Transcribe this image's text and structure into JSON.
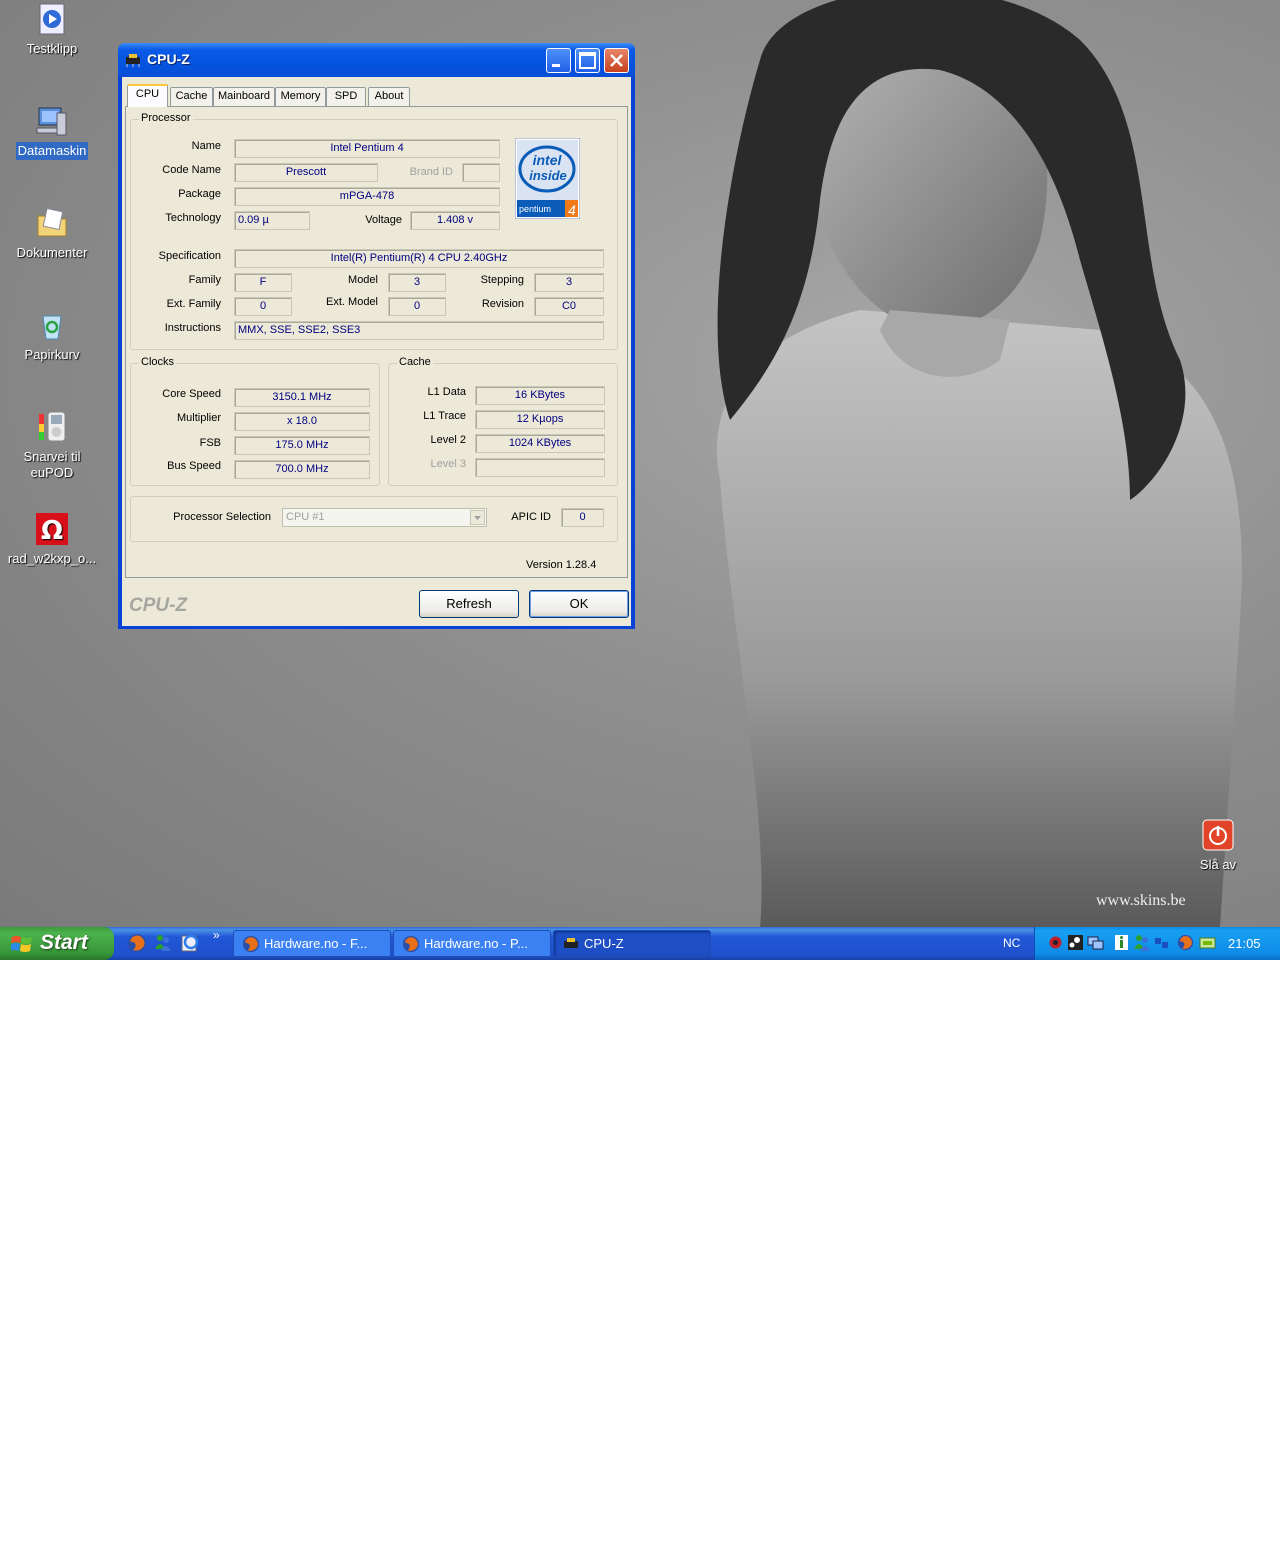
{
  "desktop": {
    "icons": [
      {
        "label": "Testklipp",
        "icon": "media-clip-icon"
      },
      {
        "label": "Datamaskin",
        "icon": "computer-icon"
      },
      {
        "label": "Dokumenter",
        "icon": "documents-folder-icon"
      },
      {
        "label": "Papirkurv",
        "icon": "recycle-bin-icon"
      },
      {
        "label": "Snarvei til euPOD",
        "icon": "ipod-shortcut-icon"
      },
      {
        "label": "rad_w2kxp_o...",
        "icon": "omega-driver-icon"
      },
      {
        "label": "Slå av",
        "icon": "shutdown-icon"
      }
    ],
    "watermark": "www.skins.be"
  },
  "window": {
    "title": "CPU-Z",
    "tabs": [
      "CPU",
      "Cache",
      "Mainboard",
      "Memory",
      "SPD",
      "About"
    ],
    "processor": {
      "group_title": "Processor",
      "name_label": "Name",
      "name": "Intel Pentium 4",
      "code_name_label": "Code Name",
      "code_name": "Prescott",
      "brand_id_label": "Brand ID",
      "brand_id": "",
      "package_label": "Package",
      "package": "mPGA-478",
      "technology_label": "Technology",
      "technology": "0.09 µ",
      "voltage_label": "Voltage",
      "voltage": "1.408 v",
      "specification_label": "Specification",
      "specification": "Intel(R) Pentium(R) 4 CPU 2.40GHz",
      "family_label": "Family",
      "family": "F",
      "model_label": "Model",
      "model": "3",
      "stepping_label": "Stepping",
      "stepping": "3",
      "ext_family_label": "Ext. Family",
      "ext_family": "0",
      "ext_model_label": "Ext. Model",
      "ext_model": "0",
      "revision_label": "Revision",
      "revision": "C0",
      "instructions_label": "Instructions",
      "instructions": "MMX, SSE, SSE2, SSE3",
      "logo_text_1": "intel",
      "logo_text_2": "inside",
      "logo_text_3": "pentium",
      "logo_text_4": "4"
    },
    "clocks": {
      "group_title": "Clocks",
      "core_speed_label": "Core Speed",
      "core_speed": "3150.1 MHz",
      "multiplier_label": "Multiplier",
      "multiplier": "x 18.0",
      "fsb_label": "FSB",
      "fsb": "175.0 MHz",
      "bus_speed_label": "Bus Speed",
      "bus_speed": "700.0 MHz"
    },
    "cache": {
      "group_title": "Cache",
      "l1_data_label": "L1 Data",
      "l1_data": "16 KBytes",
      "l1_trace_label": "L1 Trace",
      "l1_trace": "12 Kµops",
      "level2_label": "Level 2",
      "level2": "1024 KBytes",
      "level3_label": "Level 3",
      "level3": ""
    },
    "selection": {
      "processor_selection_label": "Processor Selection",
      "processor_selection_value": "CPU #1",
      "apic_id_label": "APIC ID",
      "apic_id": "0"
    },
    "version": "Version 1.28.4",
    "brand": "CPU-Z",
    "refresh_label": "Refresh",
    "ok_label": "OK"
  },
  "taskbar": {
    "start_label": "Start",
    "quick_launch_chevron": "»",
    "tasks": [
      "Hardware.no - F...",
      "Hardware.no - P...",
      "CPU-Z"
    ],
    "language": "NC",
    "clock": "21:05"
  }
}
